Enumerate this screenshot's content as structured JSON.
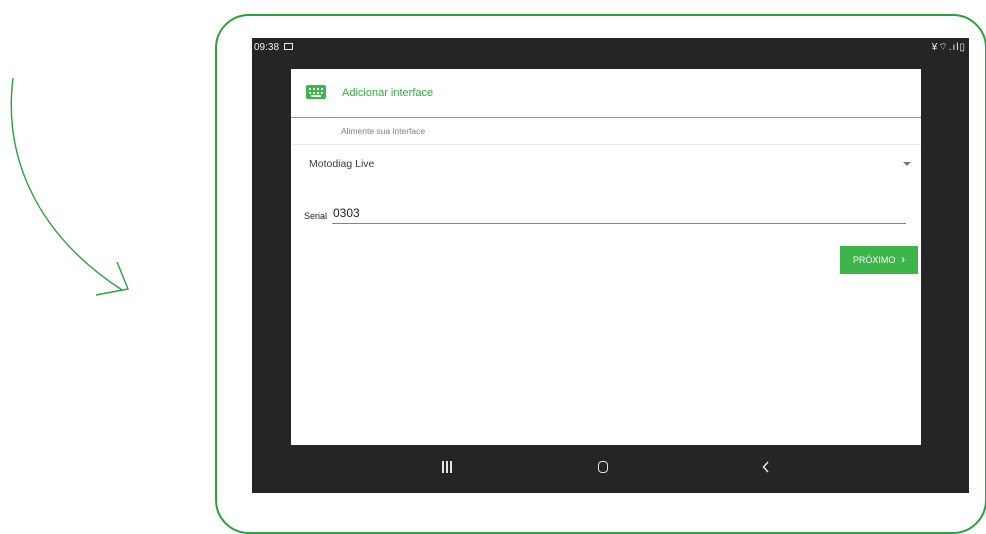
{
  "statusbar": {
    "time": "09:38",
    "indicators": "¥⌔.ıl▯"
  },
  "header": {
    "title": "Adicionar interface",
    "icon": "keyboard-icon"
  },
  "subheader": {
    "text": "Alimente sua interface"
  },
  "interface_select": {
    "selected": "Motodiag Live"
  },
  "serial": {
    "label": "Serial",
    "value": "0303"
  },
  "next_button": {
    "label": "PRÓXIMO"
  },
  "colors": {
    "accent": "#3db54a",
    "frame": "#2e9e3e",
    "device_bg": "#252527"
  }
}
